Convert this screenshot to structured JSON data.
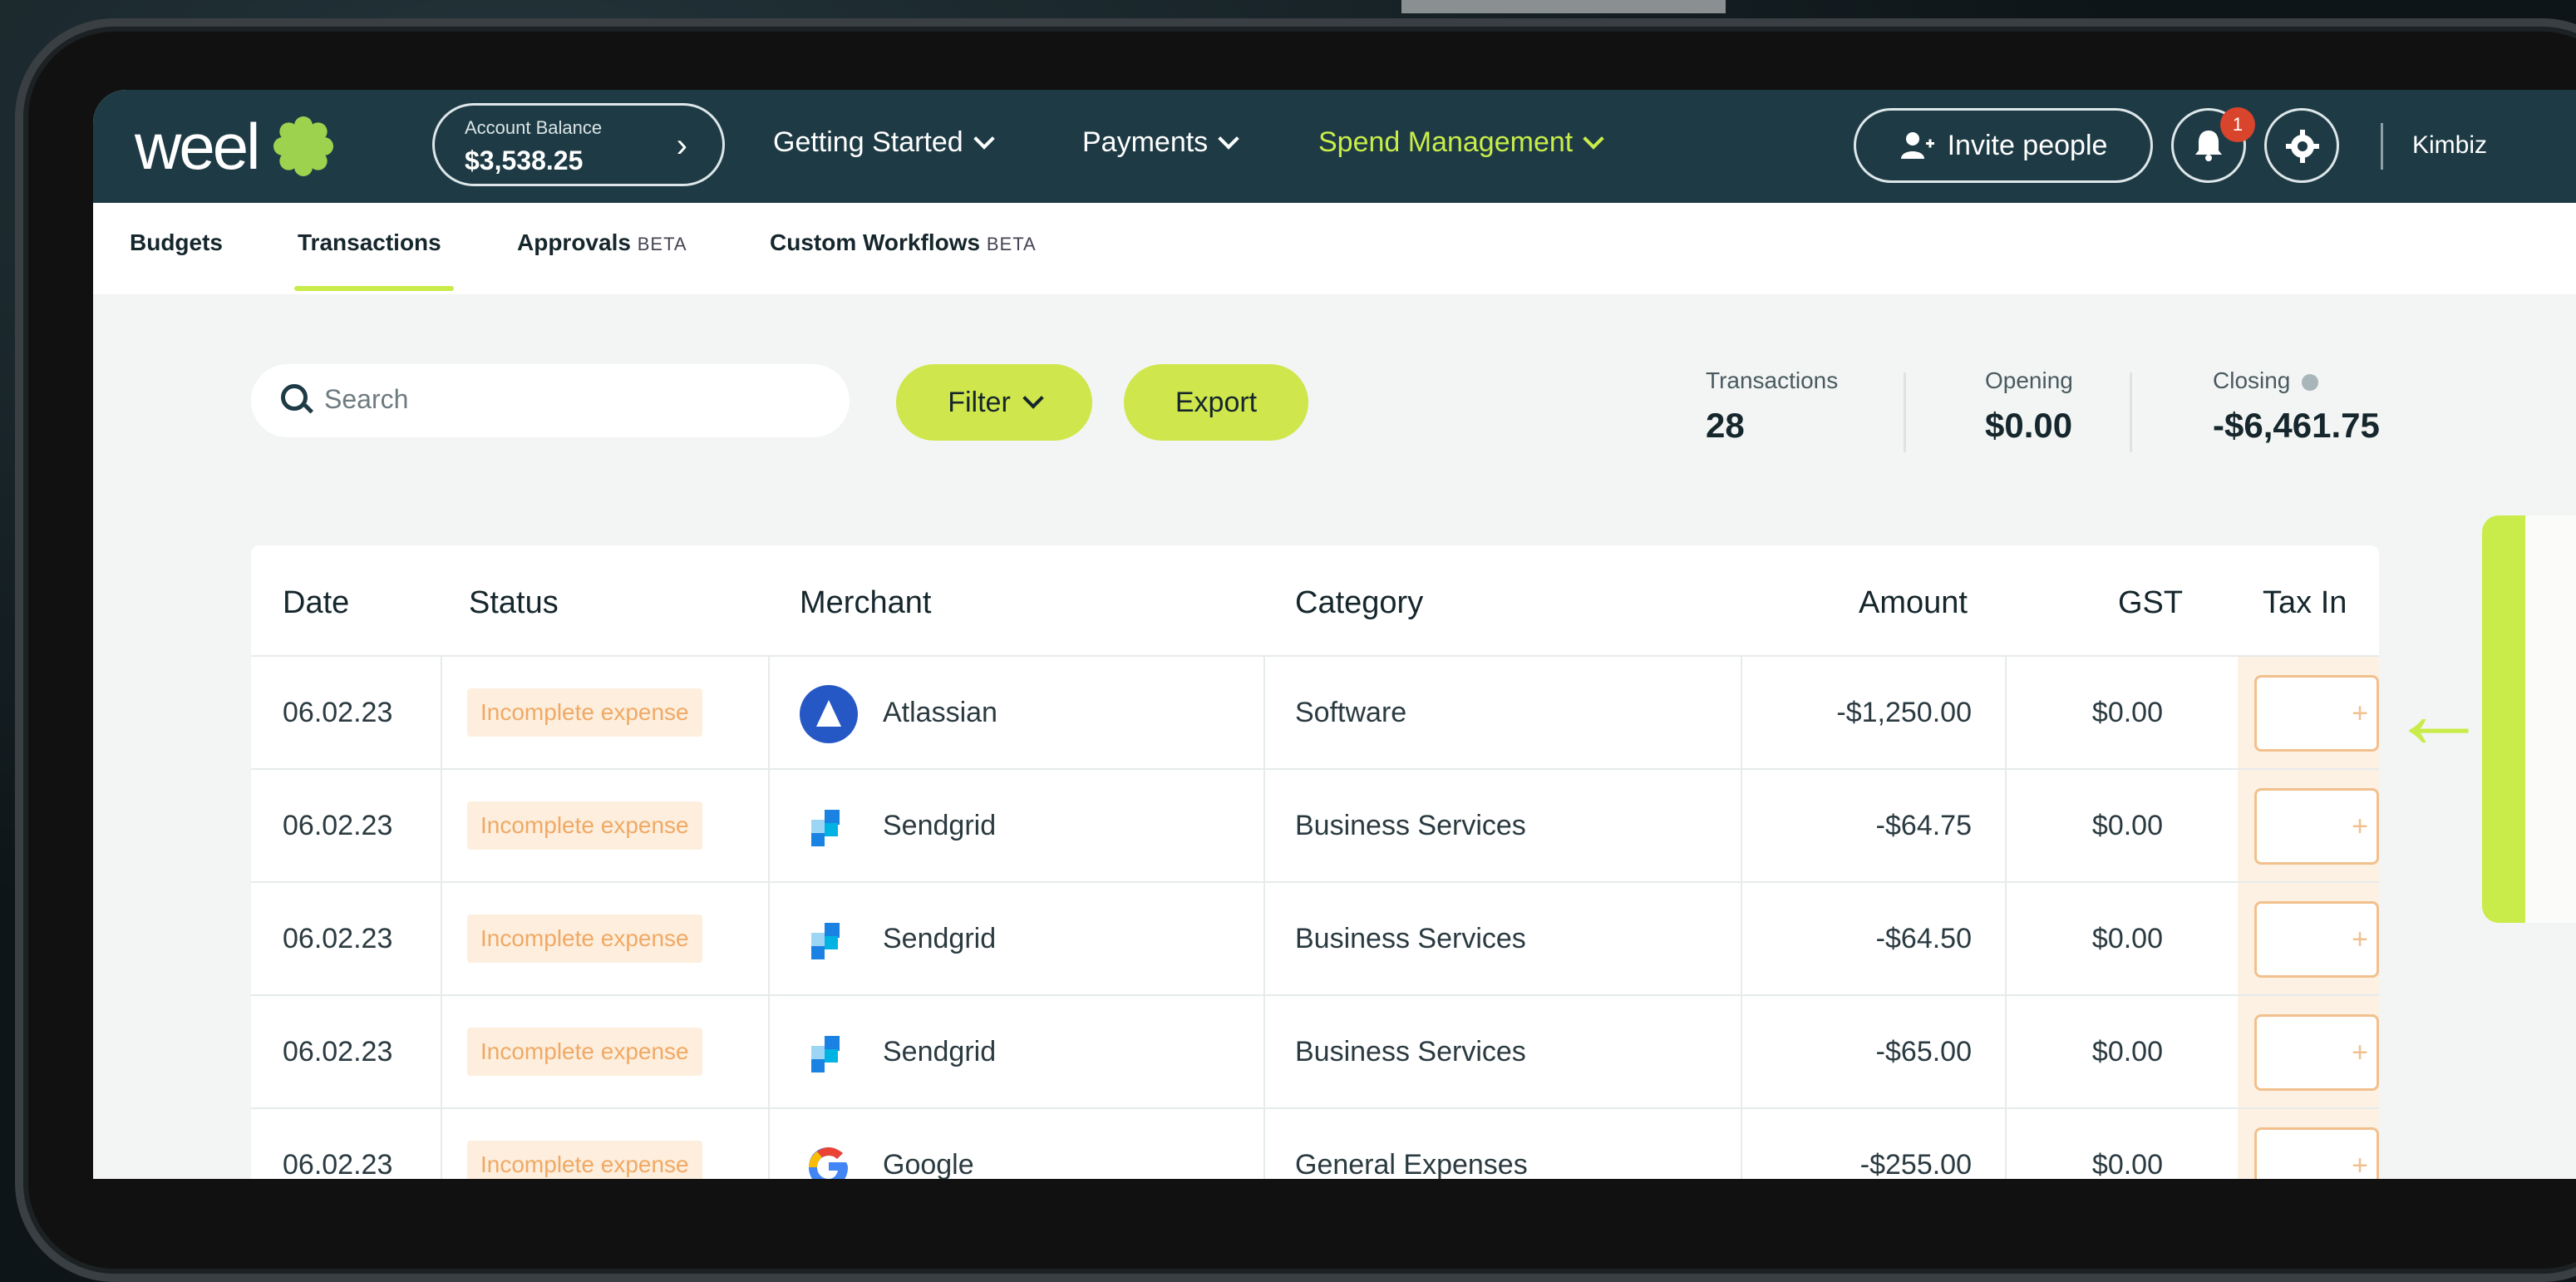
{
  "brand": {
    "name": "weel",
    "accent": "#c9ec4a",
    "nav_bg": "#1e3b45"
  },
  "account": {
    "label": "Account Balance",
    "value": "$3,538.25"
  },
  "nav": {
    "getting_started": "Getting Started",
    "payments": "Payments",
    "spend_management": "Spend Management",
    "invite": "Invite people",
    "notification_count": "1",
    "user": "Kimbiz"
  },
  "subnav": {
    "budgets": "Budgets",
    "transactions": "Transactions",
    "approvals": "Approvals",
    "custom_workflows": "Custom Workflows",
    "beta": "BETA"
  },
  "toolbar": {
    "search_placeholder": "Search",
    "filter": "Filter",
    "export": "Export"
  },
  "stats": {
    "transactions_label": "Transactions",
    "transactions_value": "28",
    "opening_label": "Opening",
    "opening_value": "$0.00",
    "closing_label": "Closing",
    "closing_value": "-$6,461.75"
  },
  "table": {
    "headers": {
      "date": "Date",
      "status": "Status",
      "merchant": "Merchant",
      "category": "Category",
      "amount": "Amount",
      "gst": "GST",
      "tax": "Tax In"
    },
    "rows": [
      {
        "date": "06.02.23",
        "status": "Incomplete expense",
        "merchant": "Atlassian",
        "icon": "atlassian-logo-icon",
        "category": "Software",
        "amount": "-$1,250.00",
        "gst": "$0.00"
      },
      {
        "date": "06.02.23",
        "status": "Incomplete expense",
        "merchant": "Sendgrid",
        "icon": "sendgrid-logo-icon",
        "category": "Business Services",
        "amount": "-$64.75",
        "gst": "$0.00"
      },
      {
        "date": "06.02.23",
        "status": "Incomplete expense",
        "merchant": "Sendgrid",
        "icon": "sendgrid-logo-icon",
        "category": "Business Services",
        "amount": "-$64.50",
        "gst": "$0.00"
      },
      {
        "date": "06.02.23",
        "status": "Incomplete expense",
        "merchant": "Sendgrid",
        "icon": "sendgrid-logo-icon",
        "category": "Business Services",
        "amount": "-$65.00",
        "gst": "$0.00"
      },
      {
        "date": "06.02.23",
        "status": "Incomplete expense",
        "merchant": "Google",
        "icon": "google-logo-icon",
        "category": "General Expenses",
        "amount": "-$255.00",
        "gst": "$0.00"
      }
    ],
    "add_symbol": "+"
  }
}
